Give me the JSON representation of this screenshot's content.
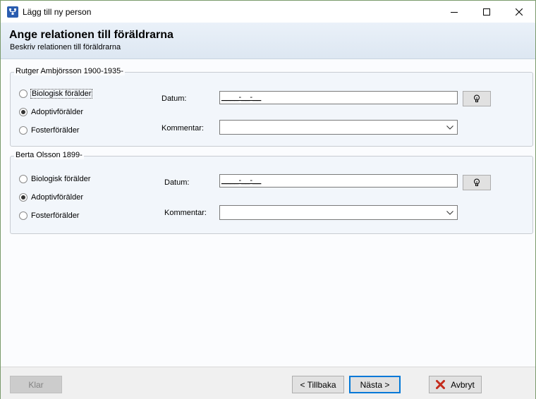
{
  "window": {
    "title": "Lägg till ny person",
    "icon": "family-tree-app-icon"
  },
  "header": {
    "title": "Ange relationen till föräldrarna",
    "subtitle": "Beskriv relationen till föräldrarna"
  },
  "parents": [
    {
      "name": "Rutger Ambjörsson 1900-1935-",
      "options": [
        {
          "label": "Biologisk förälder",
          "checked": false
        },
        {
          "label": "Adoptivförälder",
          "checked": true
        },
        {
          "label": "Fosterförälder",
          "checked": false
        }
      ],
      "date_label": "Datum:",
      "date_value": "____-__-__",
      "comment_label": "Kommentar:",
      "comment_value": ""
    },
    {
      "name": "Berta Olsson 1899-",
      "options": [
        {
          "label": "Biologisk förälder",
          "checked": false
        },
        {
          "label": "Adoptivförälder",
          "checked": true
        },
        {
          "label": "Fosterförälder",
          "checked": false
        }
      ],
      "date_label": "Datum:",
      "date_value": "____-__-__",
      "comment_label": "Kommentar:",
      "comment_value": ""
    }
  ],
  "footer": {
    "finish_label": "Klar",
    "back_label": "< Tillbaka",
    "next_label": "Nästa >",
    "cancel_label": "Avbryt"
  },
  "colors": {
    "accent": "#0078d7",
    "cancel_icon": "#c42b1c"
  }
}
